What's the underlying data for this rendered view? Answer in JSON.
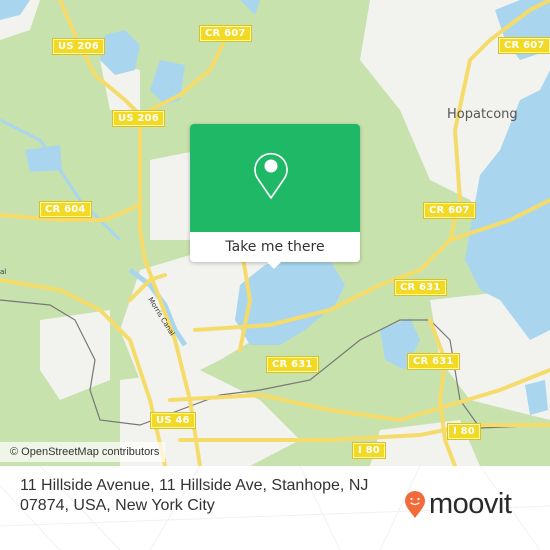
{
  "map": {
    "road_labels": [
      {
        "id": "us206-top",
        "text": "US 206"
      },
      {
        "id": "us206-mid",
        "text": "US 206"
      },
      {
        "id": "cr607-top",
        "text": "CR 607"
      },
      {
        "id": "cr607-right",
        "text": "CR 607"
      },
      {
        "id": "cr607-lower",
        "text": "CR 607"
      },
      {
        "id": "cr604",
        "text": "CR 604"
      },
      {
        "id": "cr631-right",
        "text": "CR 631"
      },
      {
        "id": "cr631-mid",
        "text": "CR 631"
      },
      {
        "id": "cr631-lower",
        "text": "CR 631"
      },
      {
        "id": "us46",
        "text": "US 46"
      },
      {
        "id": "i80-left",
        "text": "I 80"
      },
      {
        "id": "i80-right",
        "text": "I 80"
      }
    ],
    "place_labels": [
      {
        "id": "hopatcong",
        "text": "Hopatcong"
      }
    ],
    "water_labels": [
      {
        "id": "morris-canal",
        "text": "Morris Canal"
      },
      {
        "id": "canal-left",
        "text": "al"
      }
    ],
    "colors": {
      "forest": "#c8e2ad",
      "urban": "#f2f2ef",
      "water": "#a9d6ee",
      "road": "#f5dc6a",
      "shield": "#f1d924",
      "rail": "#777777",
      "popup_green": "#1fb866"
    }
  },
  "popup": {
    "icon": "location-pin-icon",
    "button_label": "Take me there"
  },
  "attribution": "© OpenStreetMap contributors",
  "footer": {
    "address": "11 Hillside Avenue, 11 Hillside Ave, Stanhope, NJ 07874, USA, New York City",
    "brand": "moovit",
    "brand_color": "#f26b3a"
  }
}
